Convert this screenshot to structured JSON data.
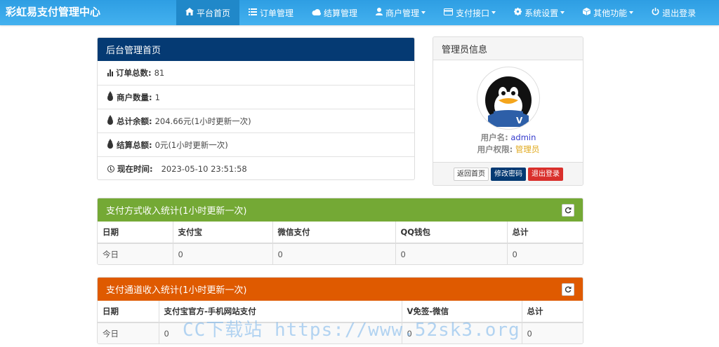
{
  "brand": "彩虹易支付管理中心",
  "nav": [
    {
      "label": "平台首页",
      "icon": "home-icon",
      "active": true,
      "dropdown": false
    },
    {
      "label": "订单管理",
      "icon": "list-icon",
      "active": false,
      "dropdown": false
    },
    {
      "label": "结算管理",
      "icon": "cloud-icon",
      "active": false,
      "dropdown": false
    },
    {
      "label": "商户管理",
      "icon": "user-icon",
      "active": false,
      "dropdown": true
    },
    {
      "label": "支付接口",
      "icon": "credit-card-icon",
      "active": false,
      "dropdown": true
    },
    {
      "label": "系统设置",
      "icon": "gear-icon",
      "active": false,
      "dropdown": true
    },
    {
      "label": "其他功能",
      "icon": "cube-icon",
      "active": false,
      "dropdown": true
    },
    {
      "label": "退出登录",
      "icon": "power-icon",
      "active": false,
      "dropdown": false
    }
  ],
  "overview": {
    "title": "后台管理首页",
    "rows": [
      {
        "label": "订单总数:",
        "value": "81",
        "note": "",
        "icon": "bar-chart-icon"
      },
      {
        "label": "商户数量:",
        "value": "1",
        "note": "",
        "icon": "tint-icon"
      },
      {
        "label": "总计余额:",
        "value": "204.66元",
        "note": "(1小时更新一次)",
        "icon": "tint-icon"
      },
      {
        "label": "结算总额:",
        "value": "0元",
        "note": "(1小时更新一次)",
        "icon": "tint-icon"
      },
      {
        "label": "现在时间:",
        "value": "2023-05-10 23:51:58",
        "note": "",
        "icon": "clock-icon"
      }
    ]
  },
  "admin": {
    "title": "管理员信息",
    "username_label": "用户名:",
    "username": "admin",
    "role_label": "用户权限:",
    "role": "管理员",
    "buttons": {
      "home": "返回首页",
      "password": "修改密码",
      "logout": "退出登录"
    }
  },
  "paymethod": {
    "title": "支付方式收入统计(1小时更新一次)",
    "headers": [
      "日期",
      "支付宝",
      "微信支付",
      "QQ钱包",
      "总计"
    ],
    "rows": [
      [
        "今日",
        "0",
        "0",
        "0",
        "0"
      ]
    ]
  },
  "channel": {
    "title": "支付通道收入统计(1小时更新一次)",
    "headers": [
      "日期",
      "支付宝官方-手机网站支付",
      "V免签-微信",
      "总计"
    ],
    "rows": [
      [
        "今日",
        "0",
        "0",
        "0"
      ]
    ]
  },
  "watermark": "CC下载站 https://www.52sk3.org",
  "colors": {
    "nav": "#35a4e8",
    "blue": "#053a73",
    "green": "#74a935",
    "orange": "#df5a00",
    "red": "#d9302c"
  }
}
